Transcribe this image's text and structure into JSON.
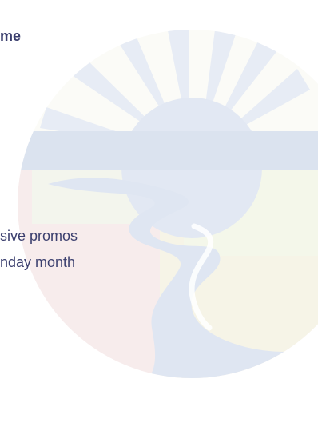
{
  "content": {
    "heading_fragment": "me",
    "lines": [
      "sive promos",
      "nday month"
    ]
  },
  "watermark": {
    "icon": "sun-over-river-logo",
    "colors": {
      "rays": "#e7ecf5",
      "sun": "#e2e8f3",
      "horizon": "#dbe3ef",
      "river": "#dfe6f2",
      "land_left": "#f7ecec",
      "land_right": "#f6f4e7",
      "land_top_right": "#f4f7ea",
      "land_top_left": "#f3f5ed"
    }
  },
  "theme": {
    "text_color": "#3b3f6e"
  }
}
